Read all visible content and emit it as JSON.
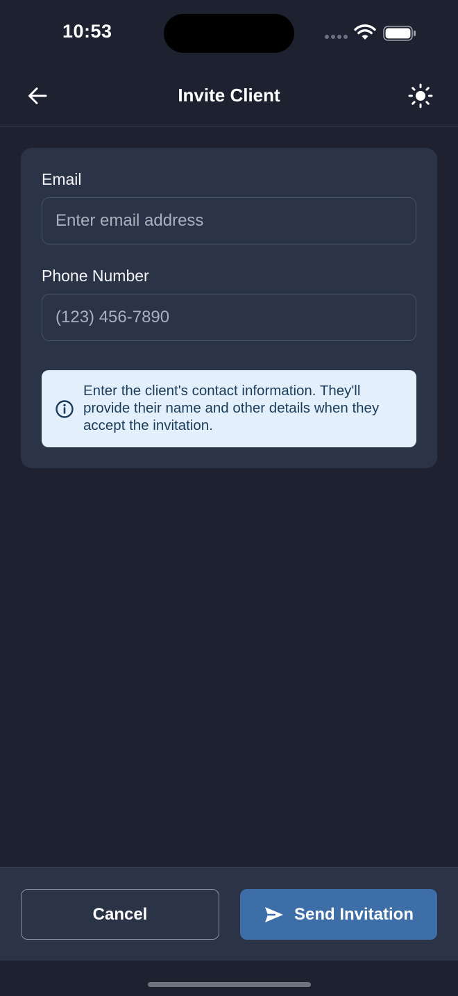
{
  "status_bar": {
    "time": "10:53",
    "icons": [
      "cellular-icon",
      "wifi-icon",
      "battery-icon"
    ]
  },
  "header": {
    "title": "Invite Client",
    "left_icon": "arrow-left-icon",
    "right_icon": "sun-icon"
  },
  "form": {
    "email": {
      "label": "Email",
      "value": "",
      "placeholder": "Enter email address"
    },
    "phone": {
      "label": "Phone Number",
      "value": "",
      "placeholder": "(123) 456-7890"
    },
    "info": {
      "icon": "info-icon",
      "text": "Enter the client's contact information. They'll provide their name and other details when they accept the invitation."
    }
  },
  "actions": {
    "cancel_label": "Cancel",
    "send_label": "Send Invitation",
    "send_icon": "send-icon"
  },
  "colors": {
    "background": "#1e2230",
    "card": "#2b3447",
    "primary": "#3d6ea8",
    "info_background": "#e3f0fb",
    "info_text": "#1b3c5a"
  }
}
